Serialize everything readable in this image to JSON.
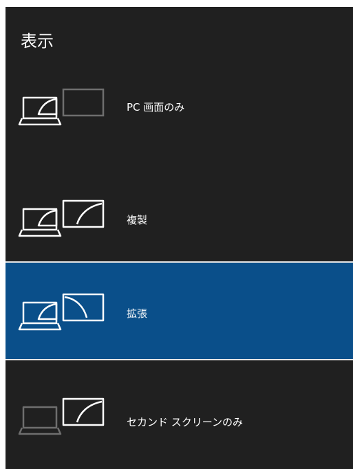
{
  "panel": {
    "title": "表示",
    "options": [
      {
        "label": "PC 画面のみ",
        "icon": "pc-screen-only-icon",
        "selected": false
      },
      {
        "label": "複製",
        "icon": "duplicate-icon",
        "selected": false
      },
      {
        "label": "拡張",
        "icon": "extend-icon",
        "selected": true
      },
      {
        "label": "セカンド スクリーンのみ",
        "icon": "second-screen-only-icon",
        "selected": false
      }
    ]
  },
  "colors": {
    "panel_background": "#202020",
    "selected_background": "#0a4f8a",
    "text": "#ffffff",
    "dim_icon": "#6e6e6e"
  }
}
